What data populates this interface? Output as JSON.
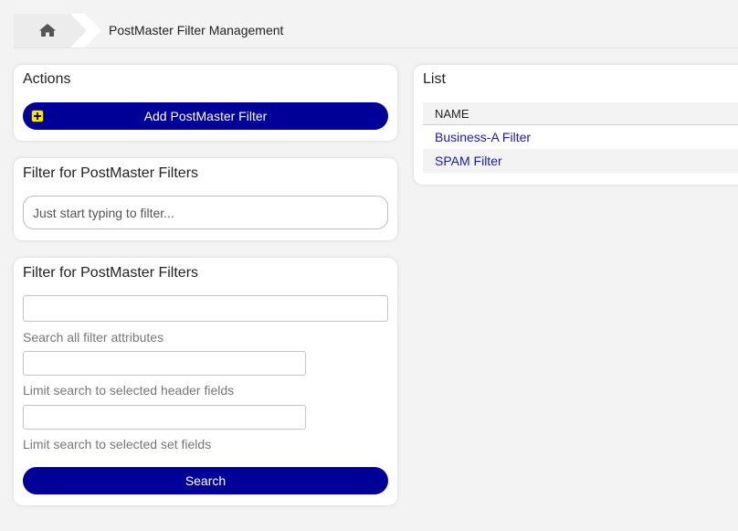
{
  "breadcrumb": {
    "home_icon": "home-icon",
    "title": "PostMaster Filter Management"
  },
  "actions": {
    "title": "Actions",
    "add_button_label": "Add PostMaster Filter",
    "add_button_icon": "plus-icon"
  },
  "quick_filter": {
    "title": "Filter for PostMaster Filters",
    "placeholder": "Just start typing to filter..."
  },
  "search_filter": {
    "title": "Filter for PostMaster Filters",
    "search_all_value": "",
    "search_all_hint": "Search all filter attributes",
    "header_fields_value": "",
    "header_fields_hint": "Limit search to selected header fields",
    "set_fields_value": "",
    "set_fields_hint": "Limit search to selected set fields",
    "search_button_label": "Search"
  },
  "list": {
    "title": "List",
    "column_header": "NAME",
    "rows": [
      {
        "name": "Business-A Filter"
      },
      {
        "name": "SPAM Filter"
      }
    ]
  },
  "colors": {
    "primary": "#000099",
    "link": "#1a1aa8",
    "background": "#f3f3f3",
    "plus_icon": "#f7e600"
  }
}
